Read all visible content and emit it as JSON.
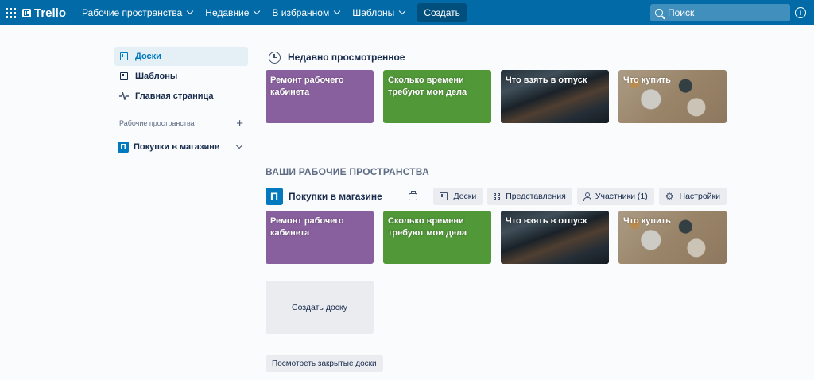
{
  "header": {
    "logo": "Trello",
    "nav": [
      {
        "label": "Рабочие пространства"
      },
      {
        "label": "Недавние"
      },
      {
        "label": "В избранном"
      },
      {
        "label": "Шаблоны"
      }
    ],
    "create_label": "Создать",
    "search_placeholder": "Поиск",
    "color": "#026aa7"
  },
  "sidebar": {
    "items": [
      {
        "label": "Доски",
        "icon": "board-icon"
      },
      {
        "label": "Шаблоны",
        "icon": "template-icon"
      },
      {
        "label": "Главная страница",
        "icon": "activity-icon"
      }
    ],
    "workspaces_header": "Рабочие пространства",
    "workspace": {
      "initial": "П",
      "label": "Покупки в магазине"
    }
  },
  "recent": {
    "title": "Недавно просмотренное",
    "boards": [
      {
        "title": "Ремонт рабочего кабинета",
        "color": "#89609e"
      },
      {
        "title": "Сколько времени требуют мои дела",
        "color": "#519839"
      },
      {
        "title": "Что взять в отпуск",
        "background": "photo-water"
      },
      {
        "title": "Что купить",
        "background": "photo-food"
      }
    ]
  },
  "workspaces": {
    "title": "ВАШИ РАБОЧИЕ ПРОСТРАНСТВА",
    "workspace": {
      "initial": "П",
      "name": "Покупки в магазине",
      "actions": {
        "boards": "Доски",
        "views": "Представления",
        "members": "Участники (1)",
        "settings": "Настройки"
      },
      "boards": [
        {
          "title": "Ремонт рабочего кабинета",
          "color": "#89609e"
        },
        {
          "title": "Сколько времени требуют мои дела",
          "color": "#519839"
        },
        {
          "title": "Что взять в отпуск",
          "background": "photo-water"
        },
        {
          "title": "Что купить",
          "background": "photo-food"
        }
      ],
      "create_board": "Создать доску"
    },
    "closed_boards": "Посмотреть закрытые доски"
  }
}
